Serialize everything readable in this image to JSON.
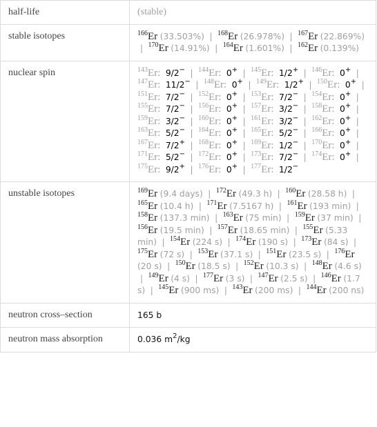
{
  "rows": {
    "half_life": {
      "label": "half-life",
      "value": "(stable)"
    },
    "stable_isotopes": {
      "label": "stable isotopes",
      "items": [
        {
          "mass": "166",
          "symbol": "Er",
          "note": "(33.503%)"
        },
        {
          "mass": "168",
          "symbol": "Er",
          "note": "(26.978%)"
        },
        {
          "mass": "167",
          "symbol": "Er",
          "note": "(22.869%)"
        },
        {
          "mass": "170",
          "symbol": "Er",
          "note": "(14.91%)"
        },
        {
          "mass": "164",
          "symbol": "Er",
          "note": "(1.601%)"
        },
        {
          "mass": "162",
          "symbol": "Er",
          "note": "(0.139%)"
        }
      ]
    },
    "nuclear_spin": {
      "label": "nuclear spin",
      "items": [
        {
          "mass": "143",
          "symbol": "Er:",
          "spin": "9/2",
          "parity": "−"
        },
        {
          "mass": "144",
          "symbol": "Er:",
          "spin": "0",
          "parity": "+"
        },
        {
          "mass": "145",
          "symbol": "Er:",
          "spin": "1/2",
          "parity": "+"
        },
        {
          "mass": "146",
          "symbol": "Er:",
          "spin": "0",
          "parity": "+"
        },
        {
          "mass": "147",
          "symbol": "Er:",
          "spin": "11/2",
          "parity": "−"
        },
        {
          "mass": "148",
          "symbol": "Er:",
          "spin": "0",
          "parity": "+"
        },
        {
          "mass": "149",
          "symbol": "Er:",
          "spin": "1/2",
          "parity": "+"
        },
        {
          "mass": "150",
          "symbol": "Er:",
          "spin": "0",
          "parity": "+"
        },
        {
          "mass": "151",
          "symbol": "Er:",
          "spin": "7/2",
          "parity": "−"
        },
        {
          "mass": "152",
          "symbol": "Er:",
          "spin": "0",
          "parity": "+"
        },
        {
          "mass": "153",
          "symbol": "Er:",
          "spin": "7/2",
          "parity": "−"
        },
        {
          "mass": "154",
          "symbol": "Er:",
          "spin": "0",
          "parity": "+"
        },
        {
          "mass": "155",
          "symbol": "Er:",
          "spin": "7/2",
          "parity": "−"
        },
        {
          "mass": "156",
          "symbol": "Er:",
          "spin": "0",
          "parity": "+"
        },
        {
          "mass": "157",
          "symbol": "Er:",
          "spin": "3/2",
          "parity": "−"
        },
        {
          "mass": "158",
          "symbol": "Er:",
          "spin": "0",
          "parity": "+"
        },
        {
          "mass": "159",
          "symbol": "Er:",
          "spin": "3/2",
          "parity": "−"
        },
        {
          "mass": "160",
          "symbol": "Er:",
          "spin": "0",
          "parity": "+"
        },
        {
          "mass": "161",
          "symbol": "Er:",
          "spin": "3/2",
          "parity": "−"
        },
        {
          "mass": "162",
          "symbol": "Er:",
          "spin": "0",
          "parity": "+"
        },
        {
          "mass": "163",
          "symbol": "Er:",
          "spin": "5/2",
          "parity": "−"
        },
        {
          "mass": "164",
          "symbol": "Er:",
          "spin": "0",
          "parity": "+"
        },
        {
          "mass": "165",
          "symbol": "Er:",
          "spin": "5/2",
          "parity": "−"
        },
        {
          "mass": "166",
          "symbol": "Er:",
          "spin": "0",
          "parity": "+"
        },
        {
          "mass": "167",
          "symbol": "Er:",
          "spin": "7/2",
          "parity": "+"
        },
        {
          "mass": "168",
          "symbol": "Er:",
          "spin": "0",
          "parity": "+"
        },
        {
          "mass": "169",
          "symbol": "Er:",
          "spin": "1/2",
          "parity": "−"
        },
        {
          "mass": "170",
          "symbol": "Er:",
          "spin": "0",
          "parity": "+"
        },
        {
          "mass": "171",
          "symbol": "Er:",
          "spin": "5/2",
          "parity": "−"
        },
        {
          "mass": "172",
          "symbol": "Er:",
          "spin": "0",
          "parity": "+"
        },
        {
          "mass": "173",
          "symbol": "Er:",
          "spin": "7/2",
          "parity": "−"
        },
        {
          "mass": "174",
          "symbol": "Er:",
          "spin": "0",
          "parity": "+"
        },
        {
          "mass": "175",
          "symbol": "Er:",
          "spin": "9/2",
          "parity": "+"
        },
        {
          "mass": "176",
          "symbol": "Er:",
          "spin": "0",
          "parity": "+"
        },
        {
          "mass": "177",
          "symbol": "Er:",
          "spin": "1/2",
          "parity": "−"
        }
      ]
    },
    "unstable_isotopes": {
      "label": "unstable isotopes",
      "items": [
        {
          "mass": "169",
          "symbol": "Er",
          "note": "(9.4 days)"
        },
        {
          "mass": "172",
          "symbol": "Er",
          "note": "(49.3 h)"
        },
        {
          "mass": "160",
          "symbol": "Er",
          "note": "(28.58 h)"
        },
        {
          "mass": "165",
          "symbol": "Er",
          "note": "(10.4 h)"
        },
        {
          "mass": "171",
          "symbol": "Er",
          "note": "(7.5167 h)"
        },
        {
          "mass": "161",
          "symbol": "Er",
          "note": "(193 min)"
        },
        {
          "mass": "158",
          "symbol": "Er",
          "note": "(137.3 min)"
        },
        {
          "mass": "163",
          "symbol": "Er",
          "note": "(75 min)"
        },
        {
          "mass": "159",
          "symbol": "Er",
          "note": "(37 min)"
        },
        {
          "mass": "156",
          "symbol": "Er",
          "note": "(19.5 min)"
        },
        {
          "mass": "157",
          "symbol": "Er",
          "note": "(18.65 min)"
        },
        {
          "mass": "155",
          "symbol": "Er",
          "note": "(5.33 min)"
        },
        {
          "mass": "154",
          "symbol": "Er",
          "note": "(224 s)"
        },
        {
          "mass": "174",
          "symbol": "Er",
          "note": "(190 s)"
        },
        {
          "mass": "173",
          "symbol": "Er",
          "note": "(84 s)"
        },
        {
          "mass": "175",
          "symbol": "Er",
          "note": "(72 s)"
        },
        {
          "mass": "153",
          "symbol": "Er",
          "note": "(37.1 s)"
        },
        {
          "mass": "151",
          "symbol": "Er",
          "note": "(23.5 s)"
        },
        {
          "mass": "176",
          "symbol": "Er",
          "note": "(20 s)"
        },
        {
          "mass": "150",
          "symbol": "Er",
          "note": "(18.5 s)"
        },
        {
          "mass": "152",
          "symbol": "Er",
          "note": "(10.3 s)"
        },
        {
          "mass": "148",
          "symbol": "Er",
          "note": "(4.6 s)"
        },
        {
          "mass": "149",
          "symbol": "Er",
          "note": "(4 s)"
        },
        {
          "mass": "177",
          "symbol": "Er",
          "note": "(3 s)"
        },
        {
          "mass": "147",
          "symbol": "Er",
          "note": "(2.5 s)"
        },
        {
          "mass": "146",
          "symbol": "Er",
          "note": "(1.7 s)"
        },
        {
          "mass": "145",
          "symbol": "Er",
          "note": "(900 ms)"
        },
        {
          "mass": "143",
          "symbol": "Er",
          "note": "(200 ms)"
        },
        {
          "mass": "144",
          "symbol": "Er",
          "note": "(200 ns)"
        }
      ]
    },
    "neutron_cross_section": {
      "label": "neutron cross–section",
      "value": "165 b"
    },
    "neutron_mass_absorption": {
      "label": "neutron mass absorption",
      "value_prefix": "0.036 m",
      "value_exp": "2",
      "value_suffix": "/kg"
    }
  },
  "separator": "|"
}
